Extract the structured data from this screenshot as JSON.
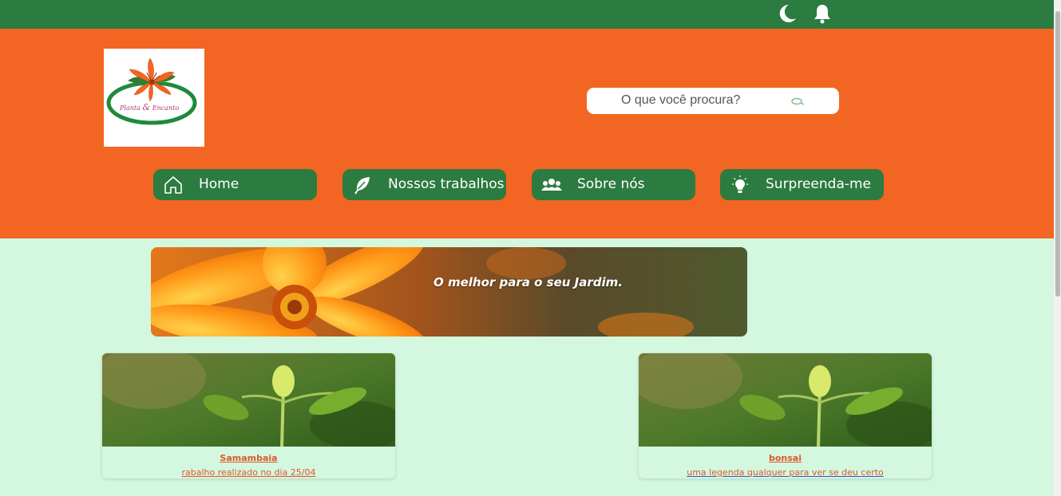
{
  "topbar": {
    "icons": [
      "moon-icon",
      "bell-icon"
    ],
    "color": "#2c7b40"
  },
  "header": {
    "color": "#f26522",
    "logo": {
      "line1": "Planta",
      "amp": "&",
      "line2": "Encanto"
    },
    "search": {
      "placeholder": "O que você procura?",
      "icon": "search-icon"
    },
    "nav": [
      {
        "label": "Home",
        "icon": "home-icon"
      },
      {
        "label": "Nossos trabalhos",
        "icon": "leaf-icon"
      },
      {
        "label": "Sobre nós",
        "icon": "users-icon"
      },
      {
        "label": "Surpreenda-me",
        "icon": "lightbulb-icon"
      }
    ]
  },
  "banner": {
    "title": "O melhor para o seu Jardim."
  },
  "cards": [
    {
      "title": "Samambaia",
      "caption": "rabalho realizado no dia 25/04"
    },
    {
      "title": "bonsai",
      "caption": "uma legenda qualquer para ver se deu certo"
    }
  ],
  "colors": {
    "page_bg": "#d3f7df",
    "green": "#2c7b40",
    "orange": "#f26522",
    "link": "#e2552a"
  }
}
